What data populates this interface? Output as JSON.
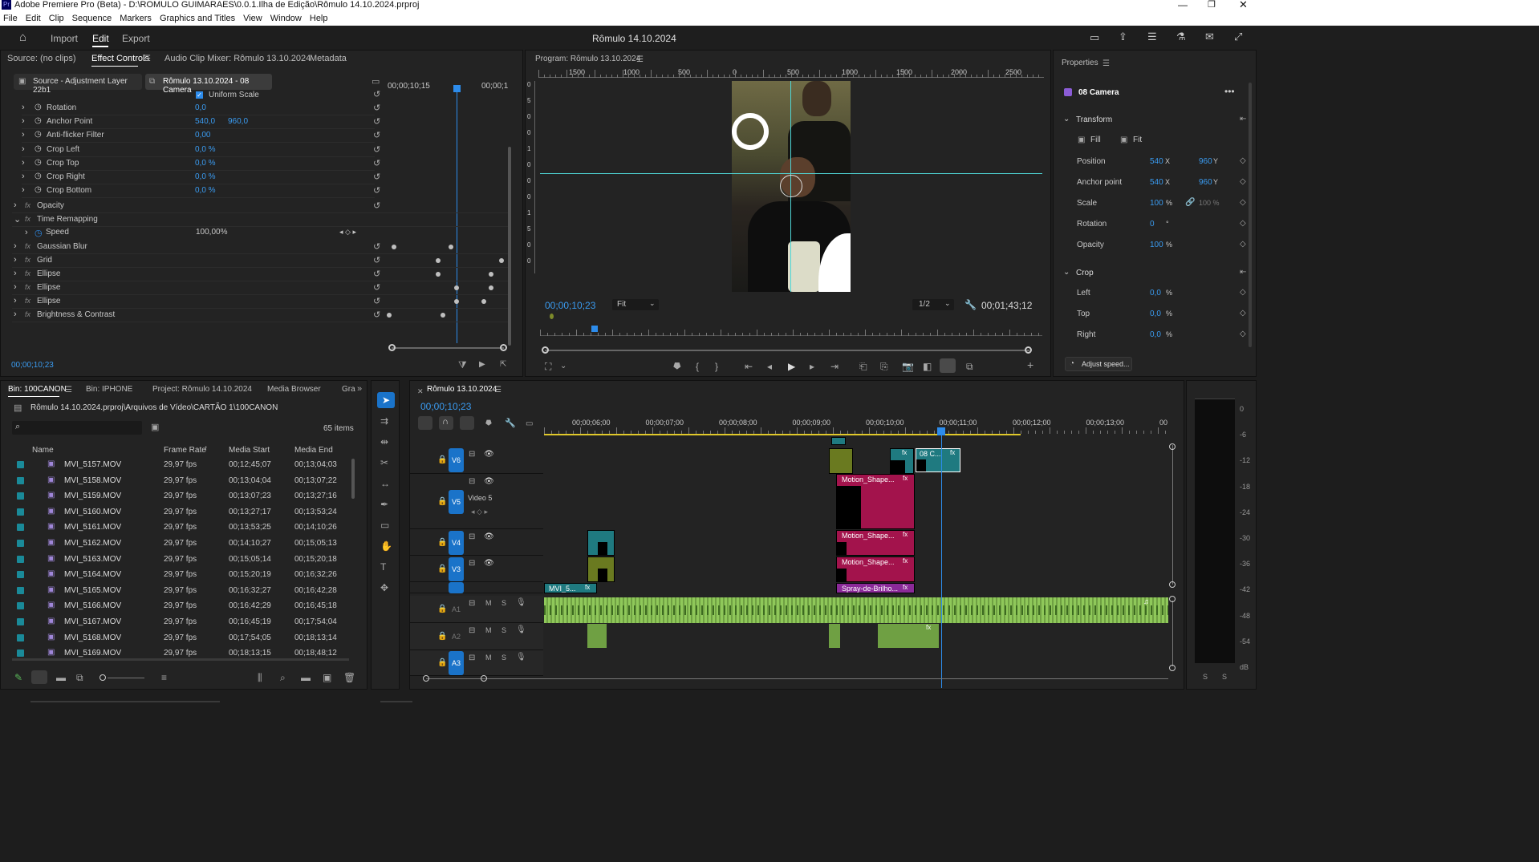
{
  "window": {
    "title": "Adobe Premiere Pro (Beta) - D:\\ROMULO GUIMARAES\\0.0.1.Ilha de Edição\\Rômulo 14.10.2024.prproj",
    "app_badge": "Pr"
  },
  "menu": [
    "File",
    "Edit",
    "Clip",
    "Sequence",
    "Markers",
    "Graphics and Titles",
    "View",
    "Window",
    "Help"
  ],
  "workspace": {
    "tabs": [
      "Import",
      "Edit",
      "Export"
    ],
    "active": "Edit",
    "project_title": "Rômulo 14.10.2024"
  },
  "effect_controls": {
    "tabs": [
      "Source: (no clips)",
      "Effect Controls",
      "Audio Clip Mixer: Rômulo 13.10.2024",
      "Metadata"
    ],
    "source_label": "Source - Adjustment Layer 22b1",
    "clip_label": "Rômulo 13.10.2024 - 08 Camera",
    "uniform_scale": "Uniform Scale",
    "time_left": "00;00;10;15",
    "time_right": "00;00;1",
    "properties": [
      {
        "name": "Rotation",
        "v1": "0,0",
        "v2": ""
      },
      {
        "name": "Anchor Point",
        "v1": "540,0",
        "v2": "960,0"
      },
      {
        "name": "Anti-flicker Filter",
        "v1": "0,00",
        "v2": ""
      },
      {
        "name": "Crop Left",
        "v1": "0,0 %",
        "v2": ""
      },
      {
        "name": "Crop Top",
        "v1": "0,0 %",
        "v2": ""
      },
      {
        "name": "Crop Right",
        "v1": "0,0 %",
        "v2": ""
      },
      {
        "name": "Crop Bottom",
        "v1": "0,0 %",
        "v2": ""
      }
    ],
    "effects": [
      "Opacity",
      "Time Remapping",
      "Gaussian Blur",
      "Grid",
      "Ellipse",
      "Ellipse",
      "Ellipse",
      "Brightness & Contrast"
    ],
    "speed_label": "Speed",
    "speed_value": "100,00%",
    "timecode": "00;00;10;23"
  },
  "program": {
    "title": "Program: Rômulo 13.10.2024",
    "ruler": [
      "1500",
      "1000",
      "500",
      "0",
      "500",
      "1000",
      "1500",
      "2000",
      "2500"
    ],
    "vruler": [
      "0",
      "5",
      "0",
      "0",
      "1",
      "0",
      "0",
      "0",
      "1",
      "5",
      "0",
      "0"
    ],
    "timecode": "00;00;10;23",
    "fit": "Fit",
    "resolution": "1/2",
    "duration": "00;01;43;12"
  },
  "properties": {
    "title": "Properties",
    "layer": "08 Camera",
    "transform": "Transform",
    "fill": "Fill",
    "fit": "Fit",
    "position": {
      "label": "Position",
      "x": "540",
      "y": "960",
      "xu": "X",
      "yu": "Y"
    },
    "anchor": {
      "label": "Anchor point",
      "x": "540",
      "y": "960",
      "xu": "X",
      "yu": "Y"
    },
    "scale": {
      "label": "Scale",
      "v": "100",
      "u": "%",
      "v2": "100 %"
    },
    "rotation": {
      "label": "Rotation",
      "v": "0",
      "u": "°"
    },
    "opacity": {
      "label": "Opacity",
      "v": "100",
      "u": "%"
    },
    "crop": "Crop",
    "left": {
      "label": "Left",
      "v": "0,0",
      "u": "%"
    },
    "top": {
      "label": "Top",
      "v": "0,0",
      "u": "%"
    },
    "right": {
      "label": "Right",
      "v": "0,0",
      "u": "%"
    },
    "adjust_speed": "Adjust speed..."
  },
  "project": {
    "tabs": [
      "Bin: 100CANON",
      "Bin: IPHONE",
      "Project: Rômulo 14.10.2024",
      "Media Browser",
      "Gra"
    ],
    "path": "Rômulo 14.10.2024.prproj\\Arquivos de Vídeo\\CARTÃO 1\\100CANON",
    "items_count": "65 items",
    "columns": [
      "Name",
      "Frame Rate",
      "Media Start",
      "Media End"
    ],
    "files": [
      [
        "MVI_5157.MOV",
        "29,97 fps",
        "00;12;45;07",
        "00;13;04;03"
      ],
      [
        "MVI_5158.MOV",
        "29,97 fps",
        "00;13;04;04",
        "00;13;07;22"
      ],
      [
        "MVI_5159.MOV",
        "29,97 fps",
        "00;13;07;23",
        "00;13;27;16"
      ],
      [
        "MVI_5160.MOV",
        "29,97 fps",
        "00;13;27;17",
        "00;13;53;24"
      ],
      [
        "MVI_5161.MOV",
        "29,97 fps",
        "00;13;53;25",
        "00;14;10;26"
      ],
      [
        "MVI_5162.MOV",
        "29,97 fps",
        "00;14;10;27",
        "00;15;05;13"
      ],
      [
        "MVI_5163.MOV",
        "29,97 fps",
        "00;15;05;14",
        "00;15;20;18"
      ],
      [
        "MVI_5164.MOV",
        "29,97 fps",
        "00;15;20;19",
        "00;16;32;26"
      ],
      [
        "MVI_5165.MOV",
        "29,97 fps",
        "00;16;32;27",
        "00;16;42;28"
      ],
      [
        "MVI_5166.MOV",
        "29,97 fps",
        "00;16;42;29",
        "00;16;45;18"
      ],
      [
        "MVI_5167.MOV",
        "29,97 fps",
        "00;16;45;19",
        "00;17;54;04"
      ],
      [
        "MVI_5168.MOV",
        "29,97 fps",
        "00;17;54;05",
        "00;18;13;14"
      ],
      [
        "MVI_5169.MOV",
        "29,97 fps",
        "00;18;13;15",
        "00;18;48;12"
      ]
    ]
  },
  "timeline": {
    "title": "Rômulo 13.10.2024",
    "timecode": "00;00;10;23",
    "ruler": [
      "00;00;06;00",
      "00;00;07;00",
      "00;00;08;00",
      "00;00;09;00",
      "00;00;10;00",
      "00;00;11;00",
      "00;00;12;00",
      "00;00;13;00",
      "00"
    ],
    "tracks": {
      "v6": "V6",
      "v5": "V5",
      "v5name": "Video 5",
      "v4": "V4",
      "v3": "V3",
      "a1": "A1",
      "a2": "A2",
      "a3": "A3",
      "m": "M",
      "s": "S"
    },
    "clips": {
      "camera": "08 C...",
      "motion1": "Motion_Shape...",
      "motion2": "Motion_Shape...",
      "motion3": "Motion_Shape...",
      "spray": "Spray-de-Brilho...",
      "mvi": "MVI_5...",
      "fx": "fx"
    }
  },
  "meter": {
    "labels": [
      "0",
      "-6",
      "-12",
      "-18",
      "-24",
      "-30",
      "-36",
      "-42",
      "-48",
      "-54",
      "dB"
    ],
    "bottom": [
      "S",
      "S"
    ]
  },
  "colors": {
    "accent": "#2d8ceb",
    "clip_teal": "#1f7a80",
    "clip_magenta": "#a3134c",
    "clip_green": "#6a8a2a",
    "audio_green": "#8fc85a"
  }
}
